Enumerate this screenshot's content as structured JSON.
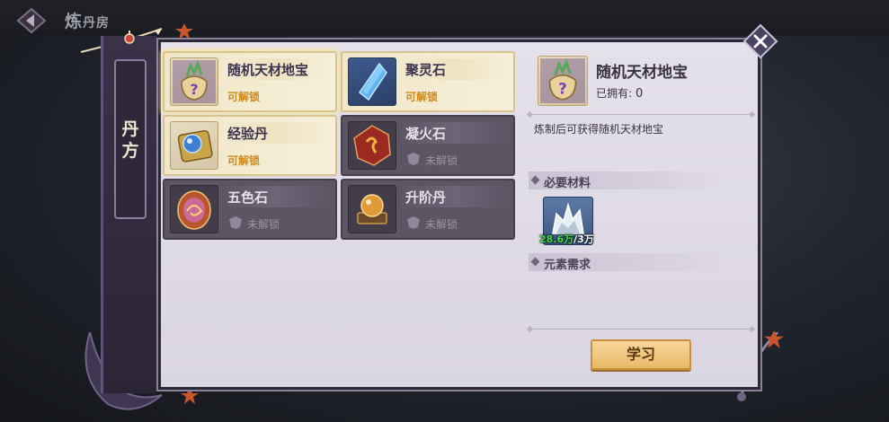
{
  "scene": {
    "title_big": "炼",
    "title_small": "丹房"
  },
  "side_tab": {
    "label": "丹方"
  },
  "recipes": [
    {
      "name": "随机天材地宝",
      "status": "可解锁",
      "state": "unlockable",
      "icon": "treasure-bag-icon"
    },
    {
      "name": "聚灵石",
      "status": "可解锁",
      "state": "unlockable",
      "icon": "spirit-crystal-icon"
    },
    {
      "name": "经验丹",
      "status": "可解锁",
      "state": "unlockable",
      "icon": "exp-pill-icon"
    },
    {
      "name": "凝火石",
      "status": "未解锁",
      "state": "locked",
      "icon": "fire-stone-icon"
    },
    {
      "name": "五色石",
      "status": "未解锁",
      "state": "locked",
      "icon": "five-color-stone-icon"
    },
    {
      "name": "升阶丹",
      "status": "未解锁",
      "state": "locked",
      "icon": "advance-pill-icon"
    }
  ],
  "detail": {
    "name": "随机天材地宝",
    "owned_label": "已拥有:",
    "owned_count": "0",
    "description": "炼制后可获得随机天材地宝",
    "materials_header": "必要材料",
    "material": {
      "icon": "silver-ore-icon",
      "have": "28.6万",
      "need": "/3万"
    },
    "elements_header": "元素需求",
    "learn_button": "学习"
  },
  "colors": {
    "unlock_text": "#d08b1c",
    "have_ok": "#3fe04a",
    "button": "#e9b866"
  }
}
